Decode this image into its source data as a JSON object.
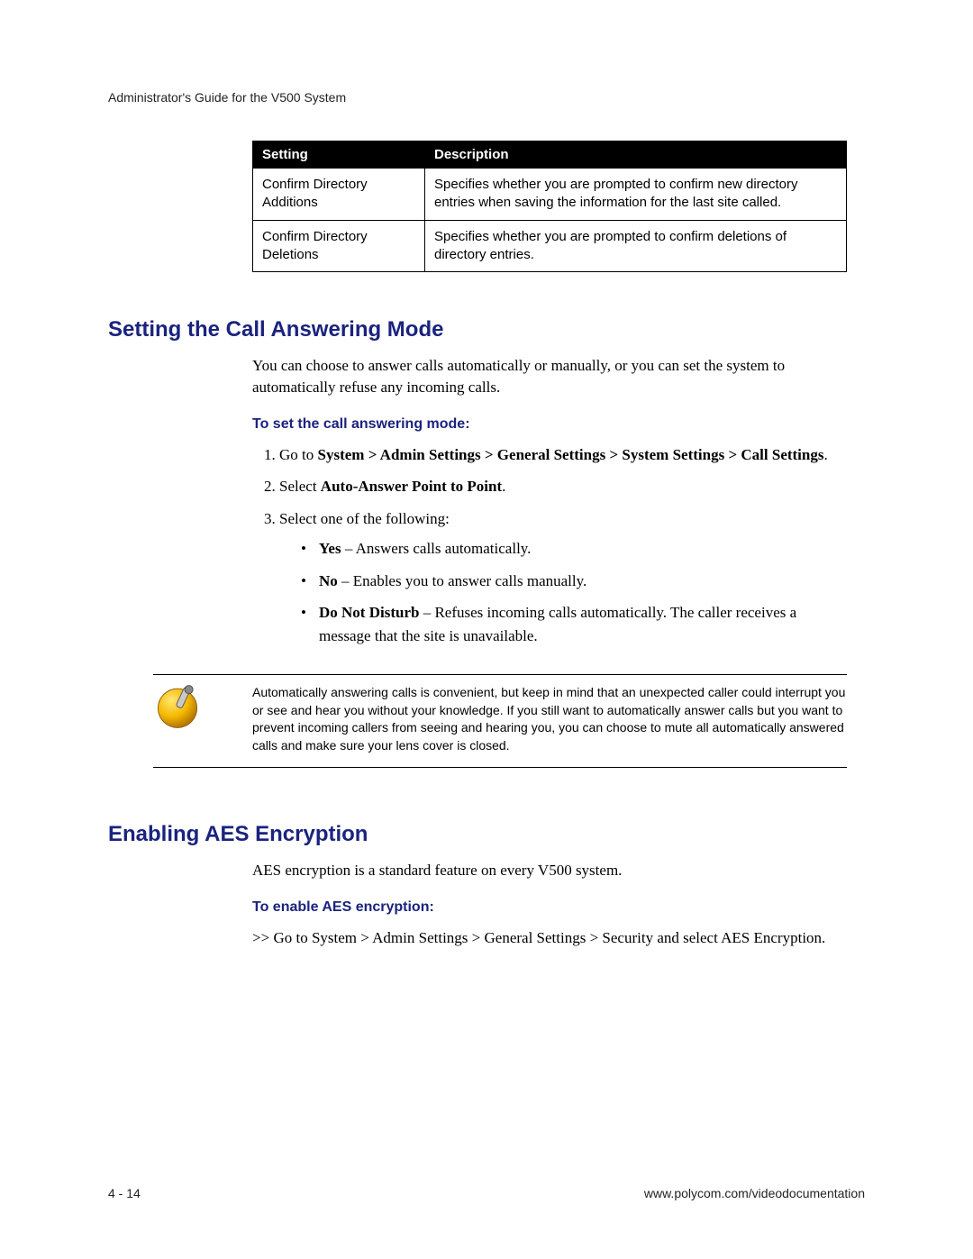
{
  "running_head": "Administrator's Guide for the V500 System",
  "table": {
    "headers": {
      "setting": "Setting",
      "description": "Description"
    },
    "rows": [
      {
        "name": "Confirm Directory Additions",
        "desc": "Specifies whether you are prompted to confirm new directory entries when saving the information for the last site called."
      },
      {
        "name": "Confirm Directory Deletions",
        "desc": "Specifies whether you are prompted to confirm deletions of directory entries."
      }
    ]
  },
  "section1": {
    "title": "Setting the Call Answering Mode",
    "intro": "You can choose to answer calls automatically or manually, or you can set the system to automatically refuse any incoming calls.",
    "subhead": "To set the call answering mode:",
    "step1_prefix": "Go to ",
    "step1_bold": "System > Admin Settings > General Settings > System Settings > Call Settings",
    "step1_suffix": ".",
    "step2_prefix": "Select ",
    "step2_bold": "Auto-Answer Point to Point",
    "step2_suffix": ".",
    "step3": "Select one of the following:",
    "opts": {
      "yes_bold": "Yes",
      "yes_rest": " – Answers calls automatically.",
      "no_bold": "No",
      "no_rest": " – Enables you to answer calls manually.",
      "dnd_bold": "Do Not Disturb",
      "dnd_rest": " – Refuses incoming calls automatically. The caller receives a message that the site is unavailable."
    }
  },
  "note": "Automatically answering calls is convenient, but keep in mind that an unexpected caller could interrupt you or see and hear you without your knowledge. If you still want to automatically answer calls but you want to prevent incoming callers from seeing and hearing you, you can choose to mute all automatically answered calls and make sure your lens cover is closed.",
  "section2": {
    "title": "Enabling AES Encryption",
    "intro": "AES encryption is a standard feature on every V500 system.",
    "subhead": "To enable AES encryption:",
    "step_marker": ">> ",
    "step_prefix": "Go to ",
    "step_bold1": "System > Admin Settings > General Settings > Security",
    "step_mid": " and select ",
    "step_bold2": "AES Encryption",
    "step_suffix": "."
  },
  "footer": {
    "left": "4 - 14",
    "right": "www.polycom.com/videodocumentation"
  }
}
